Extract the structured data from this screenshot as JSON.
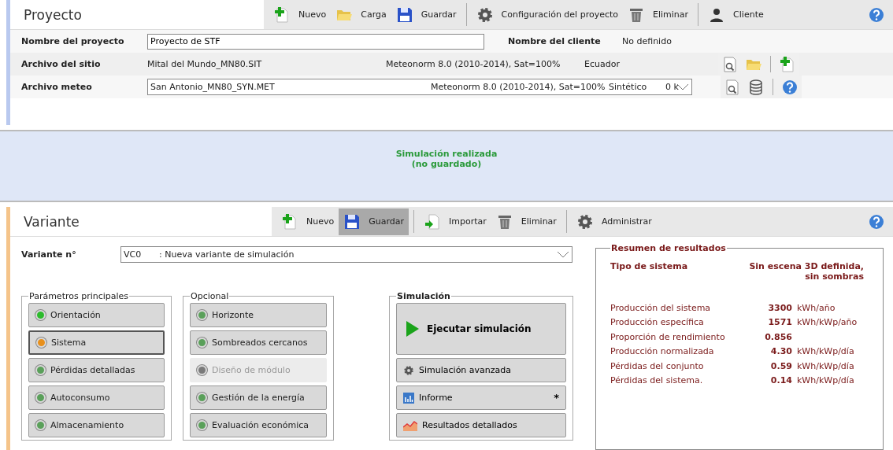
{
  "project": {
    "title": "Proyecto",
    "toolbar": [
      [
        {
          "kind": "new",
          "label": "Nuevo",
          "selected": false
        },
        {
          "kind": "open",
          "label": "Carga",
          "selected": false
        },
        {
          "kind": "save",
          "label": "Guardar",
          "selected": false
        }
      ],
      [
        {
          "kind": "settings",
          "label": "Configuración del proyecto",
          "selected": false
        },
        {
          "kind": "delete",
          "label": "Eliminar",
          "selected": false
        }
      ],
      [
        {
          "kind": "user",
          "label": "Cliente",
          "selected": false
        }
      ]
    ],
    "name_row": {
      "label": "Nombre del proyecto",
      "value": "Proyecto de STF",
      "client_label": "Nombre del cliente",
      "client_value": "No definido"
    },
    "site_row": {
      "label": "Archivo del sitio",
      "file": "Mital del Mundo_MN80.SIT",
      "source": "Meteonorm 8.0 (2010-2014), Sat=100%",
      "country": "Ecuador",
      "actions": [
        [
          {
            "kind": "preview"
          },
          {
            "kind": "open"
          }
        ],
        [
          {
            "kind": "new"
          }
        ]
      ]
    },
    "meteo_row": {
      "label": "Archivo meteo",
      "file": "San Antonio_MN80_SYN.MET",
      "source": "Meteonorm 8.0 (2010-2014), Sat=100%",
      "type": "Sintético",
      "extra": "0 k",
      "actions": [
        [
          {
            "kind": "preview"
          },
          {
            "kind": "database"
          }
        ],
        [
          {
            "kind": "help"
          }
        ]
      ]
    }
  },
  "status": {
    "message": [
      "Simulación realizada",
      "(no guardado)"
    ]
  },
  "variant": {
    "title": "Variante",
    "toolbar": [
      [
        {
          "kind": "new",
          "label": "Nuevo",
          "selected": false
        },
        {
          "kind": "save",
          "label": "Guardar",
          "selected": true
        }
      ],
      [
        {
          "kind": "import",
          "label": "Importar",
          "selected": false
        },
        {
          "kind": "delete",
          "label": "Eliminar",
          "selected": false
        }
      ],
      [
        {
          "kind": "settings",
          "label": "Administrar",
          "selected": false
        }
      ]
    ],
    "number_label": "Variante n°",
    "number": "VC0",
    "description": ": Nueva variante de simulación",
    "main": {
      "legend": "Parámetros principales",
      "items": [
        {
          "label": "Orientación",
          "color": "#2dbb2d",
          "selected": false,
          "disabled": false
        },
        {
          "label": "Sistema",
          "color": "#e8901c",
          "selected": true,
          "disabled": false
        },
        {
          "label": "Pérdidas detalladas",
          "color": "#5aa05a",
          "selected": false,
          "disabled": false
        },
        {
          "label": "Autoconsumo",
          "color": "#5aa05a",
          "selected": false,
          "disabled": false
        },
        {
          "label": "Almacenamiento",
          "color": "#5aa05a",
          "selected": false,
          "disabled": false
        }
      ]
    },
    "optional": {
      "legend": "Opcional",
      "items": [
        {
          "label": "Horizonte",
          "color": "#5aa05a",
          "selected": false,
          "disabled": false
        },
        {
          "label": "Sombreados cercanos",
          "color": "#5aa05a",
          "selected": false,
          "disabled": false
        },
        {
          "label": "Diseño de módulo",
          "color": "#7a7a7a",
          "selected": false,
          "disabled": true
        },
        {
          "label": "Gestión de la energía",
          "color": "#5aa05a",
          "selected": false,
          "disabled": false
        },
        {
          "label": "Evaluación económica",
          "color": "#5aa05a",
          "selected": false,
          "disabled": false
        }
      ]
    },
    "simulation": {
      "legend": "Simulación",
      "run": "Ejecutar simulación",
      "items": [
        {
          "kind": "settings",
          "label": "Simulación avanzada"
        },
        {
          "kind": "report",
          "label": "Informe",
          "mark": "*"
        },
        {
          "kind": "chart",
          "label": "Resultados detallados"
        }
      ]
    },
    "results": {
      "legend": "Resumen de resultados",
      "type_label": "Tipo de sistema",
      "type_value": "Sin escena 3D definida, sin sombras",
      "rows": [
        {
          "label": "Producción del sistema",
          "value": "3300",
          "unit": "kWh/año"
        },
        {
          "label": "Producción específica",
          "value": "1571",
          "unit": "kWh/kWp/año"
        },
        {
          "label": "Proporción de rendimiento",
          "value": "0.856"
        },
        {
          "label": "Producción normalizada",
          "value": "4.30",
          "unit": "kWh/kWp/día"
        },
        {
          "label": "Pérdidas del conjunto",
          "value": "0.59",
          "unit": "kWh/kWp/día"
        },
        {
          "label": "Pérdidas del sistema.",
          "value": "0.14",
          "unit": "kWh/kWp/día"
        }
      ]
    }
  }
}
